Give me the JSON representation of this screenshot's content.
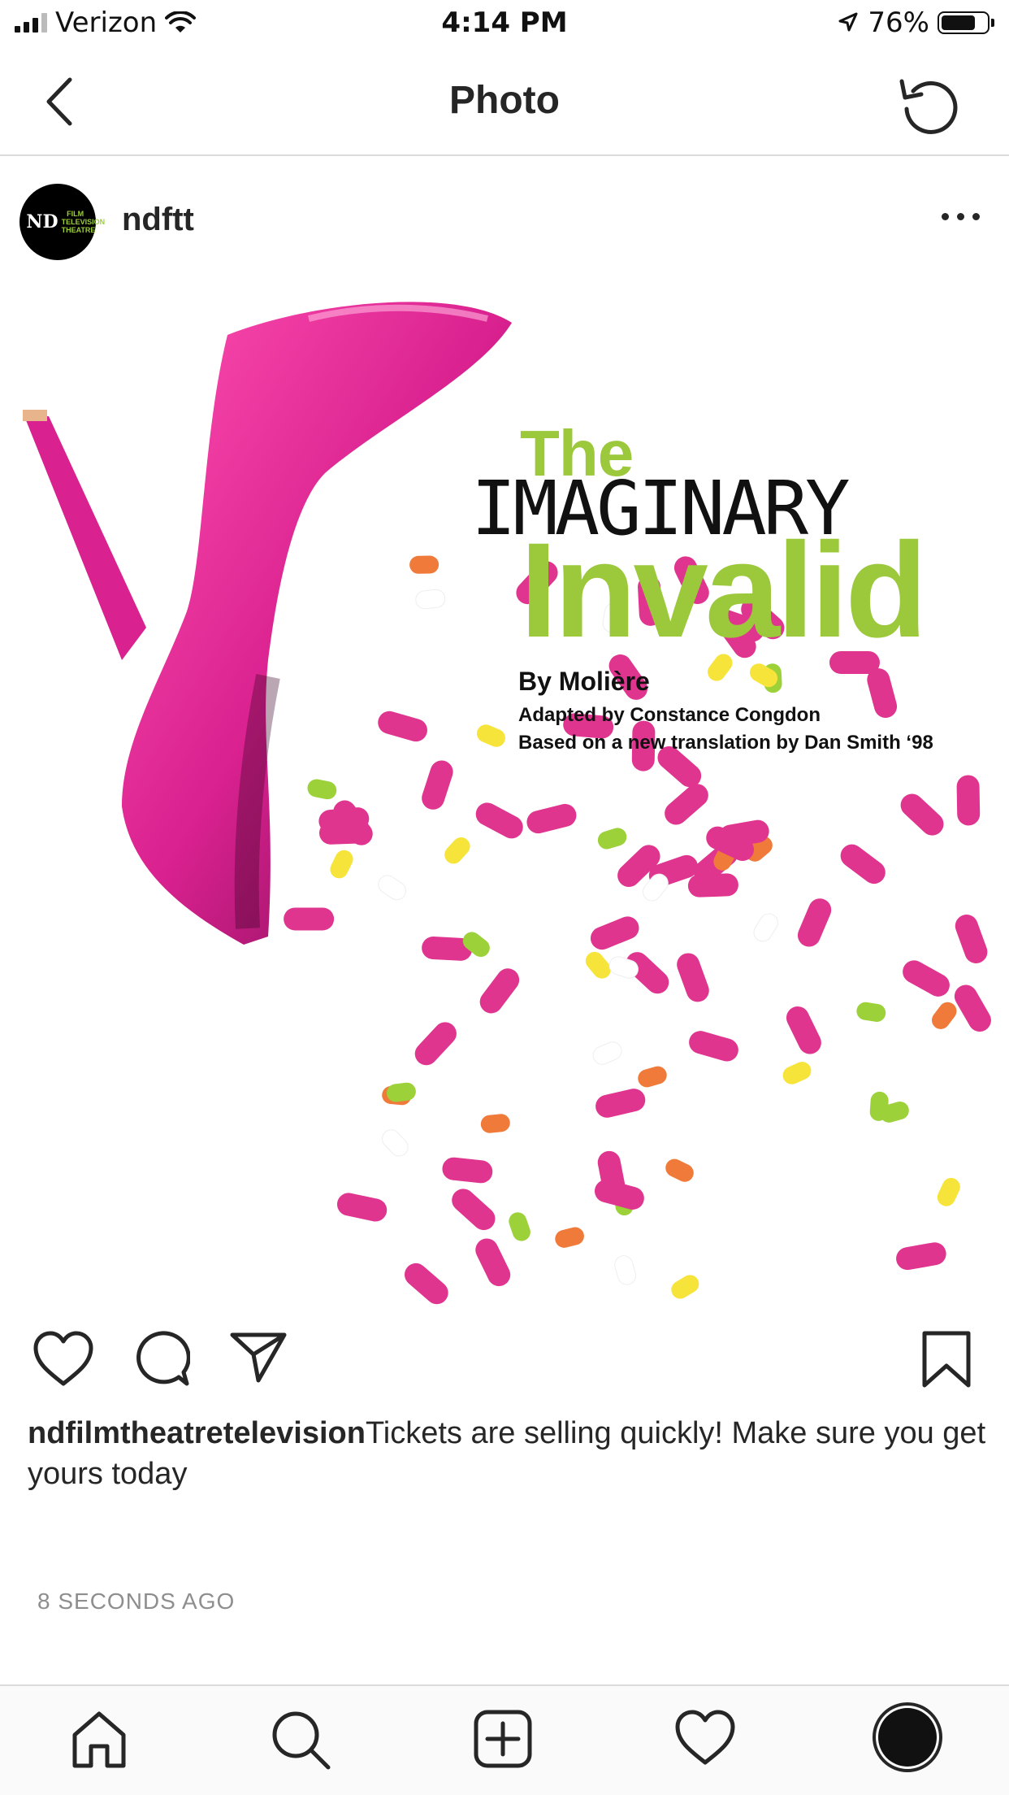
{
  "status_bar": {
    "carrier": "Verizon",
    "time": "4:14 PM",
    "battery_percent": "76%",
    "battery_level": 0.76,
    "icons": [
      "signal-icon",
      "wifi-icon",
      "location-icon",
      "battery-icon"
    ]
  },
  "nav": {
    "title": "Photo",
    "back_icon": "chevron-left-icon",
    "refresh_icon": "refresh-icon"
  },
  "post": {
    "username": "ndftt",
    "avatar_mono": "ND",
    "avatar_text": "FILM TELEVISION THEATRE",
    "more_icon": "more-horizontal-icon"
  },
  "poster": {
    "the": "The",
    "imaginary": "IMAGINARY",
    "invalid": "Invalid",
    "by": "By Molière",
    "adapted": "Adapted by Constance Congdon",
    "based": "Based on a new translation by Dan Smith ‘98",
    "colors": {
      "shoe": "#d9218f",
      "title_green": "#9cc83b",
      "pill_pink": "#e0358f"
    }
  },
  "actions": {
    "icons": [
      "heart-icon",
      "comment-icon",
      "share-icon",
      "bookmark-icon"
    ]
  },
  "caption": {
    "username": "ndfilmtheatretelevision",
    "text": "Tickets are selling quickly! Make sure you get yours today"
  },
  "timestamp": "8 SECONDS AGO",
  "tab_bar": {
    "icons": [
      "home-icon",
      "search-icon",
      "add-post-icon",
      "activity-heart-icon",
      "profile-icon"
    ]
  }
}
